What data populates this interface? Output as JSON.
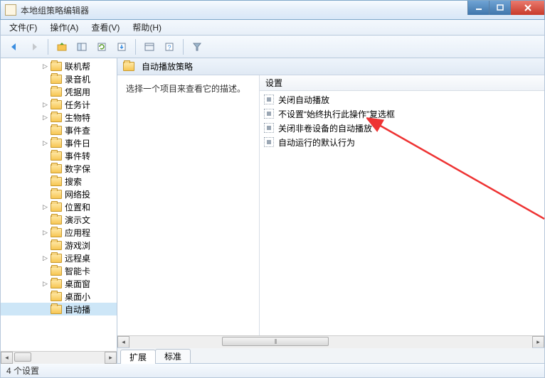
{
  "window": {
    "title": "本地组策略编辑器"
  },
  "menu": {
    "file": "文件(F)",
    "action": "操作(A)",
    "view": "查看(V)",
    "help": "帮助(H)"
  },
  "toolbar": {
    "back": "back-icon",
    "forward": "forward-icon",
    "up": "up-icon",
    "show": "show-icon",
    "refresh": "refresh-icon",
    "export": "export-icon",
    "properties": "properties-icon",
    "help": "help-icon",
    "filter": "filter-icon"
  },
  "tree": {
    "items": [
      {
        "label": "联机帮",
        "expander": "▷"
      },
      {
        "label": "录音机",
        "expander": ""
      },
      {
        "label": "凭据用",
        "expander": ""
      },
      {
        "label": "任务计",
        "expander": "▷"
      },
      {
        "label": "生物特",
        "expander": "▷"
      },
      {
        "label": "事件查",
        "expander": ""
      },
      {
        "label": "事件日",
        "expander": "▷"
      },
      {
        "label": "事件转",
        "expander": ""
      },
      {
        "label": "数字保",
        "expander": ""
      },
      {
        "label": "搜索",
        "expander": ""
      },
      {
        "label": "网络投",
        "expander": ""
      },
      {
        "label": "位置和",
        "expander": "▷"
      },
      {
        "label": "演示文",
        "expander": ""
      },
      {
        "label": "应用程",
        "expander": "▷"
      },
      {
        "label": "游戏浏",
        "expander": ""
      },
      {
        "label": "远程桌",
        "expander": "▷"
      },
      {
        "label": "智能卡",
        "expander": ""
      },
      {
        "label": "桌面窗",
        "expander": "▷"
      },
      {
        "label": "桌面小",
        "expander": ""
      },
      {
        "label": "自动播",
        "expander": "",
        "selected": true
      }
    ]
  },
  "rightPane": {
    "headerTitle": "自动播放策略",
    "description": "选择一个项目来查看它的描述。",
    "columnHeader": "设置",
    "settings": [
      "关闭自动播放",
      "不设置“始终执行此操作”复选框",
      "关闭非卷设备的自动播放",
      "自动运行的默认行为"
    ],
    "tabs": {
      "extended": "扩展",
      "standard": "标准"
    }
  },
  "statusbar": {
    "text": "4 个设置"
  }
}
